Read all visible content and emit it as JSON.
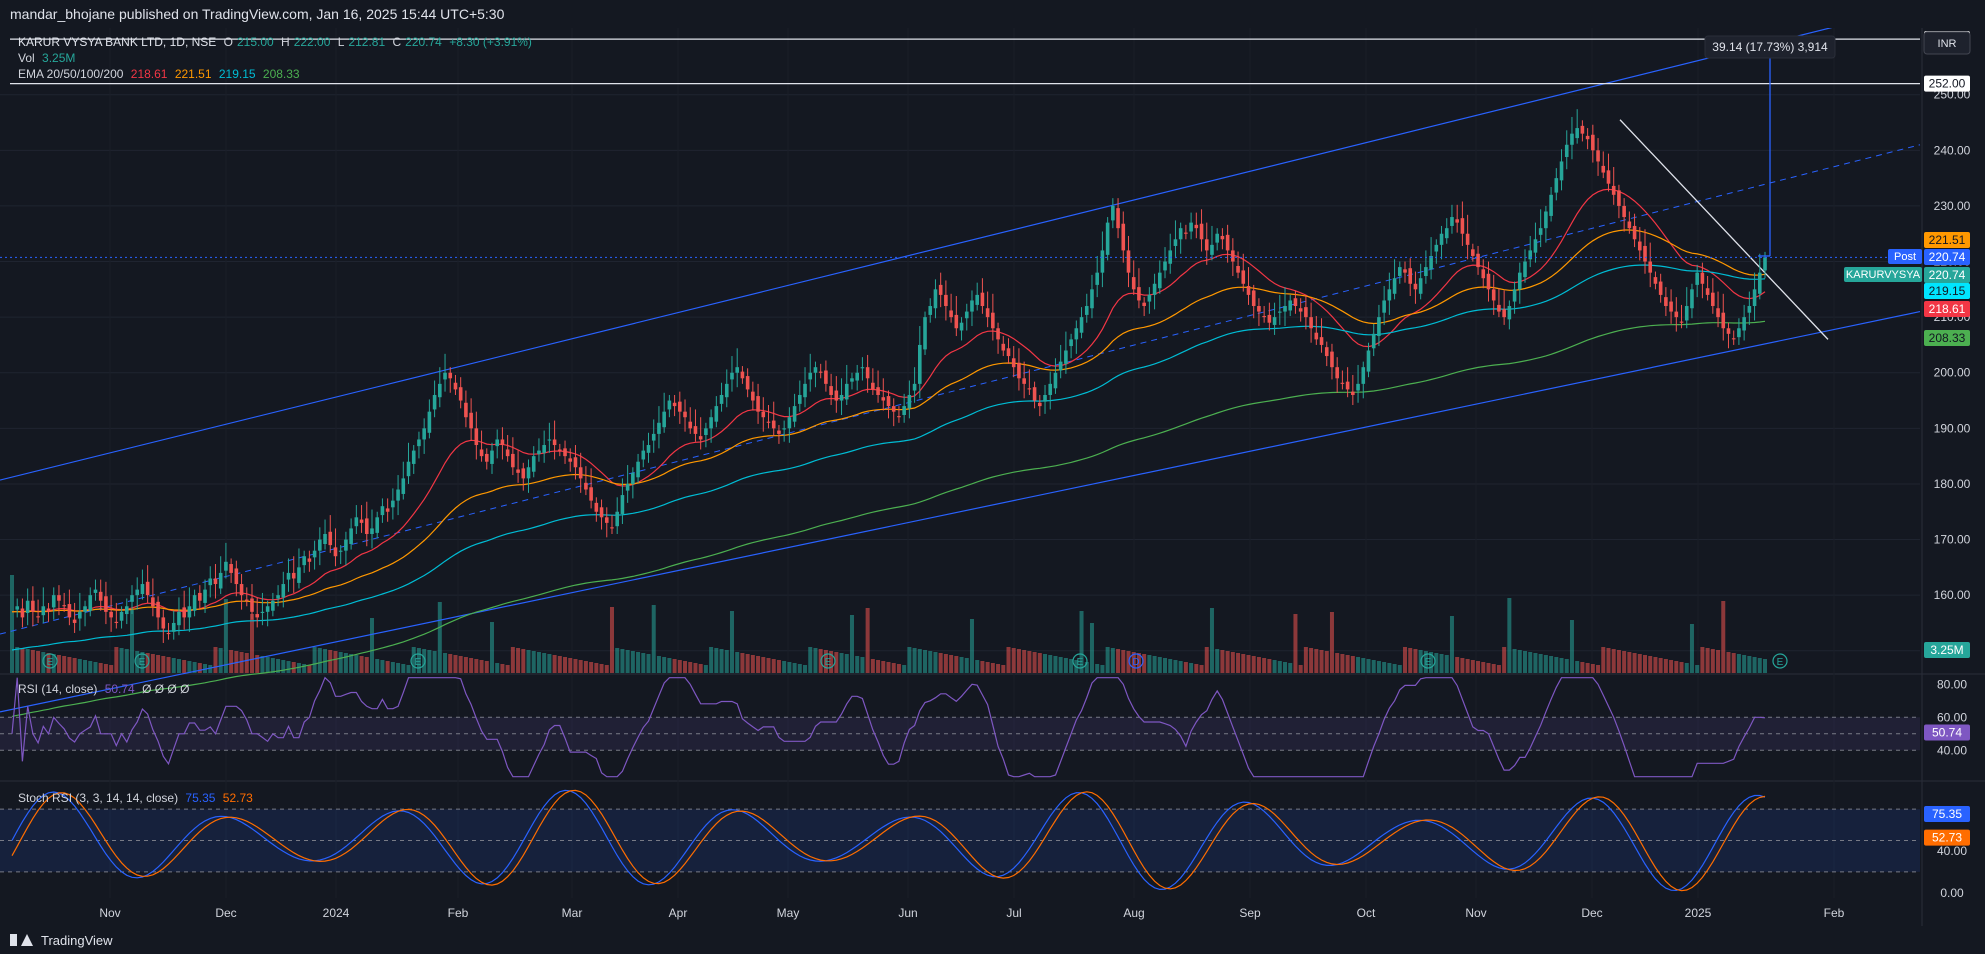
{
  "header": {
    "published_text": "mandar_bhojane published on TradingView.com, Jan 16, 2025 15:44 UTC+5:30"
  },
  "legend": {
    "symbol": "KARUR VYSYA BANK LTD, 1D, NSE",
    "open_label": "O",
    "open": "215.00",
    "high_label": "H",
    "high": "222.00",
    "low_label": "L",
    "low": "212.81",
    "close_label": "C",
    "close": "220.74",
    "change": "+8.30 (+3.91%)",
    "vol_label": "Vol",
    "vol": "3.25M",
    "ema_label": "EMA 20/50/100/200",
    "ema20": "218.61",
    "ema50": "221.51",
    "ema100": "219.15",
    "ema200": "208.33",
    "rsi_label": "RSI (14, close)",
    "rsi": "50.74",
    "rsi_extra": "Ø Ø Ø Ø",
    "stoch_label": "Stoch RSI (3, 3, 14, 14, close)",
    "stoch_k": "75.35",
    "stoch_d": "52.73"
  },
  "currency": "INR",
  "measure_label": "39.14 (17.73%) 3,914",
  "price_labels": {
    "post": "Post",
    "symbol_tag": "KARURVYSYA",
    "hline_260": "260.00",
    "hline_252": "252.00",
    "ema50_tag": "221.51",
    "post_price": "220.74",
    "last_price": "220.74",
    "ema100_tag": "219.15",
    "ema20_tag": "218.61",
    "ema200_tag": "208.33",
    "vol_tag": "3.25M",
    "rsi_tag": "50.74",
    "stoch_k_tag": "75.35",
    "stoch_d_tag": "52.73"
  },
  "footer": {
    "brand": "TradingView"
  },
  "colors": {
    "up": "#26a69a",
    "down": "#ef5350",
    "ema20": "#f23645",
    "ema50": "#ff9800",
    "ema100": "#00bcd4",
    "ema200": "#4caf50",
    "channel": "#2962ff",
    "rsi": "#7e57c2",
    "stoch_k": "#2962ff",
    "stoch_d": "#ff6d00"
  },
  "chart_data": {
    "type": "candlestick",
    "price_axis": {
      "ylim": [
        146,
        262
      ],
      "ticks": [
        150,
        160,
        170,
        180,
        190,
        200,
        210,
        220,
        230,
        240,
        250
      ]
    },
    "time_axis": {
      "labels": [
        "Nov",
        "Dec",
        "2024",
        "Feb",
        "Mar",
        "Apr",
        "May",
        "Jun",
        "Jul",
        "Aug",
        "Sep",
        "Oct",
        "Nov",
        "Dec",
        "2025",
        "Feb"
      ]
    },
    "rsi_axis": {
      "ylim": [
        22,
        85
      ],
      "ticks": [
        40,
        60,
        80
      ],
      "bands": [
        40,
        50,
        60
      ]
    },
    "stoch_axis": {
      "ylim": [
        -5,
        105
      ],
      "ticks": [
        0,
        40
      ],
      "bands": [
        20,
        50,
        80
      ]
    },
    "closes": [
      157,
      158,
      156,
      159,
      157,
      156,
      158,
      157,
      160,
      159,
      158,
      156,
      155,
      157,
      158,
      160,
      161,
      159,
      157,
      156,
      155,
      157,
      158,
      160,
      161,
      162,
      160,
      158,
      156,
      154,
      153,
      155,
      157,
      156,
      158,
      160,
      159,
      161,
      163,
      162,
      164,
      166,
      164,
      162,
      160,
      159,
      157,
      156,
      157,
      158,
      159,
      160,
      162,
      164,
      163,
      165,
      167,
      166,
      168,
      170,
      171,
      169,
      167,
      168,
      170,
      172,
      174,
      173,
      171,
      172,
      174,
      176,
      175,
      177,
      179,
      181,
      184,
      186,
      188,
      190,
      193,
      196,
      198,
      200,
      199,
      197,
      195,
      192,
      190,
      187,
      185,
      184,
      186,
      188,
      187,
      185,
      183,
      182,
      181,
      183,
      185,
      186,
      187,
      188,
      187,
      186,
      185,
      184,
      183,
      181,
      179,
      177,
      175,
      174,
      173,
      172,
      175,
      178,
      180,
      182,
      184,
      186,
      187,
      189,
      191,
      193,
      195,
      194,
      193,
      192,
      190,
      189,
      188,
      190,
      192,
      194,
      196,
      198,
      200,
      201,
      199,
      197,
      195,
      193,
      192,
      191,
      190,
      189,
      190,
      192,
      194,
      196,
      198,
      200,
      201,
      200,
      198,
      196,
      195,
      196,
      198,
      199,
      200,
      201,
      199,
      197,
      196,
      195,
      194,
      193,
      192,
      194,
      196,
      198,
      205,
      210,
      212,
      215,
      214,
      212,
      210,
      208,
      209,
      211,
      213,
      214,
      212,
      210,
      208,
      206,
      204,
      203,
      201,
      199,
      198,
      197,
      195,
      194,
      196,
      198,
      200,
      202,
      204,
      206,
      208,
      210,
      212,
      215,
      218,
      222,
      227,
      230,
      226,
      222,
      218,
      215,
      213,
      212,
      214,
      216,
      218,
      220,
      222,
      224,
      226,
      225,
      227,
      226,
      224,
      222,
      223,
      225,
      224,
      222,
      220,
      218,
      216,
      214,
      212,
      211,
      210,
      209,
      210,
      211,
      212,
      213,
      212,
      211,
      210,
      208,
      206,
      205,
      203,
      201,
      199,
      198,
      197,
      196,
      198,
      201,
      204,
      207,
      210,
      213,
      215,
      217,
      219,
      218,
      216,
      215,
      217,
      219,
      221,
      223,
      225,
      226,
      228,
      227,
      225,
      223,
      221,
      219,
      217,
      215,
      213,
      211,
      210,
      212,
      215,
      218,
      220,
      222,
      224,
      226,
      229,
      232,
      235,
      238,
      241,
      243,
      244,
      243,
      242,
      240,
      238,
      236,
      234,
      232,
      230,
      228,
      226,
      224,
      222,
      220,
      218,
      216,
      214,
      212,
      211,
      210,
      209,
      212,
      215,
      218,
      216,
      214,
      212,
      210,
      208,
      207,
      206,
      208,
      210,
      212,
      215,
      218,
      220.74
    ],
    "ema20_last": 218.61,
    "ema50_last": 221.51,
    "ema100_last": 219.15,
    "ema200_last": 208.33,
    "annotations": {
      "horizontal_levels": [
        252,
        260
      ],
      "measure": {
        "from": 221,
        "to": 260,
        "text": "39.14 (17.73%) 3,914"
      }
    }
  }
}
